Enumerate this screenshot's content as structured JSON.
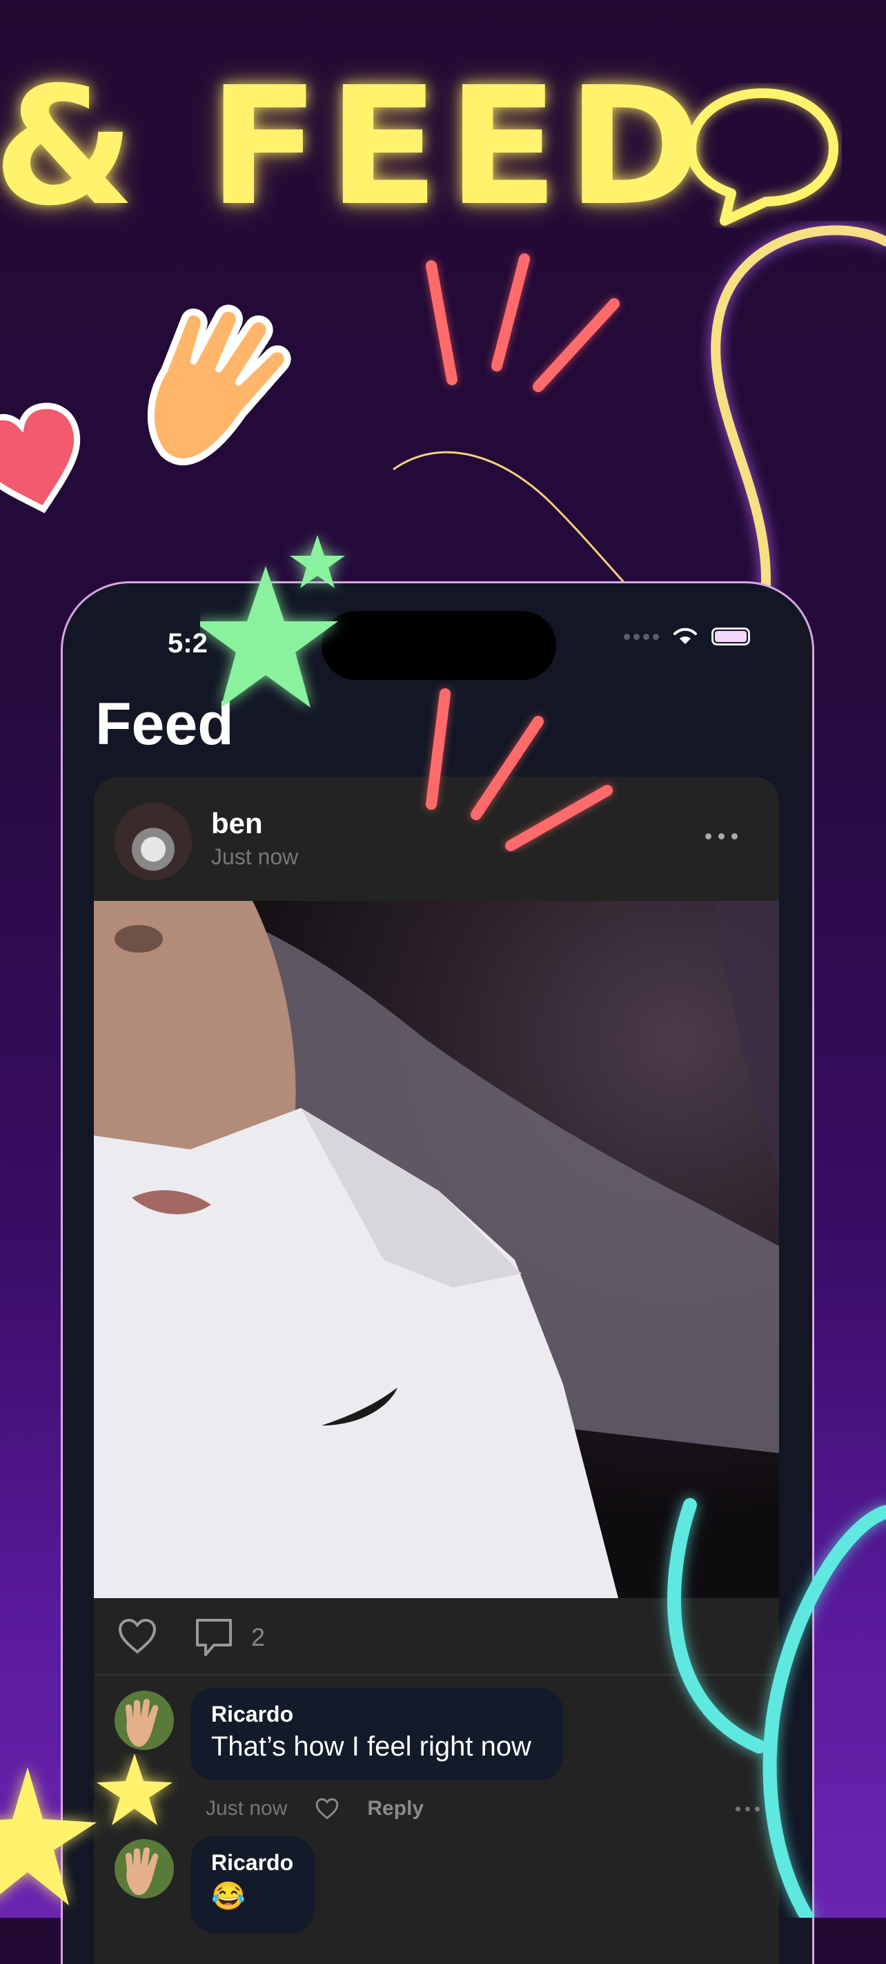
{
  "headline": "& FEED",
  "status_bar": {
    "time": "5:2"
  },
  "page": {
    "title": "Feed"
  },
  "post": {
    "username": "ben",
    "time": "Just now",
    "comment_count": "2"
  },
  "comments": [
    {
      "author": "Ricardo",
      "text": "That’s how I feel right now",
      "time": "Just now",
      "reply_label": "Reply"
    },
    {
      "author": "Ricardo",
      "text": "😂"
    }
  ],
  "colors": {
    "headline": "#fff36e",
    "neon_pink": "#ff6b6b",
    "neon_green": "#8af29e",
    "neon_cyan": "#5ee8e0",
    "neon_yellow": "#fff36e",
    "accent_purple": "#d9a6e3"
  },
  "icons": [
    "speech-bubble-icon",
    "hand-wave-icon",
    "heart-icon",
    "star-icon",
    "like-icon",
    "comment-icon",
    "more-icon",
    "wifi-icon",
    "battery-icon"
  ]
}
